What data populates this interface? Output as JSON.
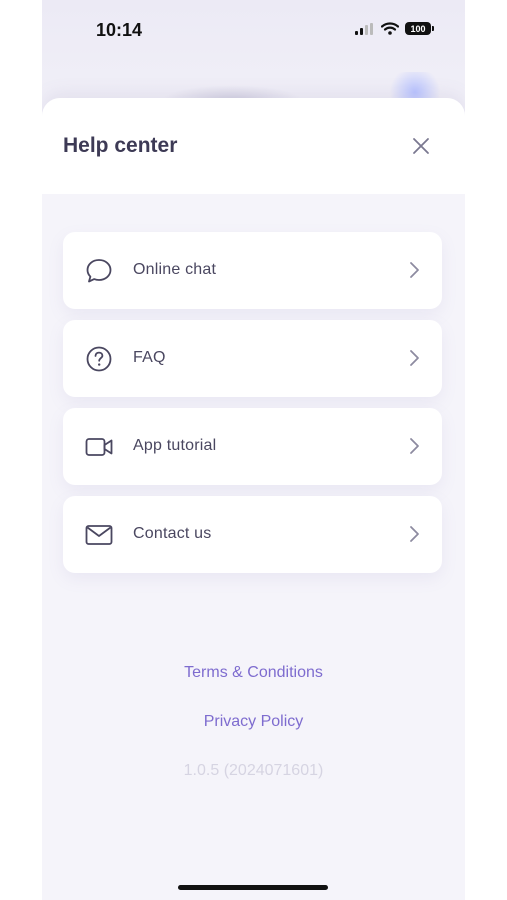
{
  "status_bar": {
    "time": "10:14",
    "battery": "100",
    "icons": [
      "signal-icon",
      "wifi-icon",
      "battery-icon"
    ]
  },
  "sheet": {
    "title": "Help center",
    "close_icon": "close-icon"
  },
  "menu": {
    "items": [
      {
        "label": "Online chat",
        "icon": "chat-bubble-icon"
      },
      {
        "label": "FAQ",
        "icon": "question-circle-icon"
      },
      {
        "label": "App tutorial",
        "icon": "video-camera-icon"
      },
      {
        "label": "Contact us",
        "icon": "mail-icon"
      }
    ]
  },
  "footer": {
    "terms": "Terms & Conditions",
    "privacy": "Privacy Policy",
    "version": "1.0.5 (2024071601)"
  },
  "colors": {
    "title": "#3d3a55",
    "link": "#7e6ccf",
    "version": "#d6d4e2",
    "icon_stroke": "#4a4760"
  }
}
